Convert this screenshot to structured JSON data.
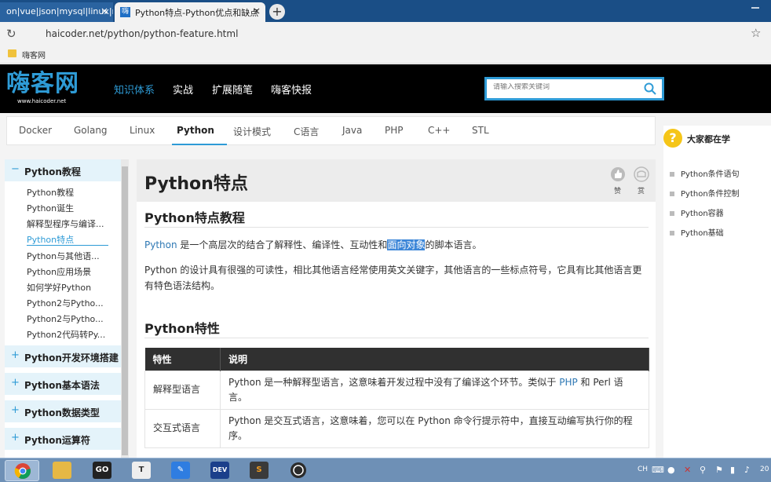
{
  "browser": {
    "tabs": [
      {
        "title": "on|vue|json|mysql|linux|re"
      },
      {
        "title": "Python特点-Python优点和缺点"
      }
    ],
    "close_glyph": "×",
    "newtab_glyph": "+",
    "url": "haicoder.net/python/python-feature.html",
    "bookmark": "嗨客网"
  },
  "site": {
    "logo": "嗨客网",
    "logo_sub": "www.haicoder.net",
    "nav": [
      "知识体系",
      "实战",
      "扩展随笔",
      "嗨客快报"
    ],
    "search_placeholder": "请输入搜索关键词",
    "subnav": [
      "Docker",
      "Golang",
      "Linux",
      "Python",
      "设计模式",
      "C语言",
      "Java",
      "PHP",
      "C++",
      "STL"
    ]
  },
  "sidebar": {
    "sections": [
      {
        "sign": "−",
        "title": "Python教程"
      },
      {
        "sign": "+",
        "title": "Python开发环境搭建"
      },
      {
        "sign": "+",
        "title": "Python基本语法"
      },
      {
        "sign": "+",
        "title": "Python数据类型"
      },
      {
        "sign": "+",
        "title": "Python运算符"
      }
    ],
    "items": [
      "Python教程",
      "Python诞生",
      "解释型程序与编译...",
      "Python特点",
      "Python与其他语...",
      "Python应用场景",
      "如何学好Python",
      "Python2与Pytho...",
      "Python2与Pytho...",
      "Python2代码转Py..."
    ]
  },
  "content": {
    "title": "Python特点",
    "action1": "赞",
    "action2": "赏",
    "h2_tutorial": "Python特点教程",
    "p1": {
      "a": "Python",
      "b": " 是一个高层次的结合了解释性、编译性、互动性和",
      "c": "面向对象",
      "d": "的脚本语言。"
    },
    "p2": "Python 的设计具有很强的可读性，相比其他语言经常使用英文关键字，其他语言的一些标点符号，它具有比其他语言更有特色语法结构。",
    "h2_features": "Python特性",
    "table": {
      "headers": [
        "特性",
        "说明"
      ],
      "row1": {
        "c1": "解释型语言",
        "a": "Python 是一种解释型语言，这意味着开发过程中没有了编译这个环节。类似于 ",
        "b": "PHP",
        "c": " 和 Perl 语言。"
      },
      "row2": {
        "c1": "交互式语言",
        "c2": "Python 是交互式语言，这意味着，您可以在 Python 命令行提示符中，直接互动编写执行你的程序。"
      }
    }
  },
  "right": {
    "title": "大家都在学",
    "items": [
      "Python条件语句",
      "Python条件控制",
      "Python容器",
      "Python基础"
    ]
  },
  "taskbar": {
    "tray_lang": "CH",
    "clock": "20"
  },
  "colors": {
    "accent": "#2e9bd6",
    "header_bg": "#000000",
    "table_header": "#303030"
  }
}
